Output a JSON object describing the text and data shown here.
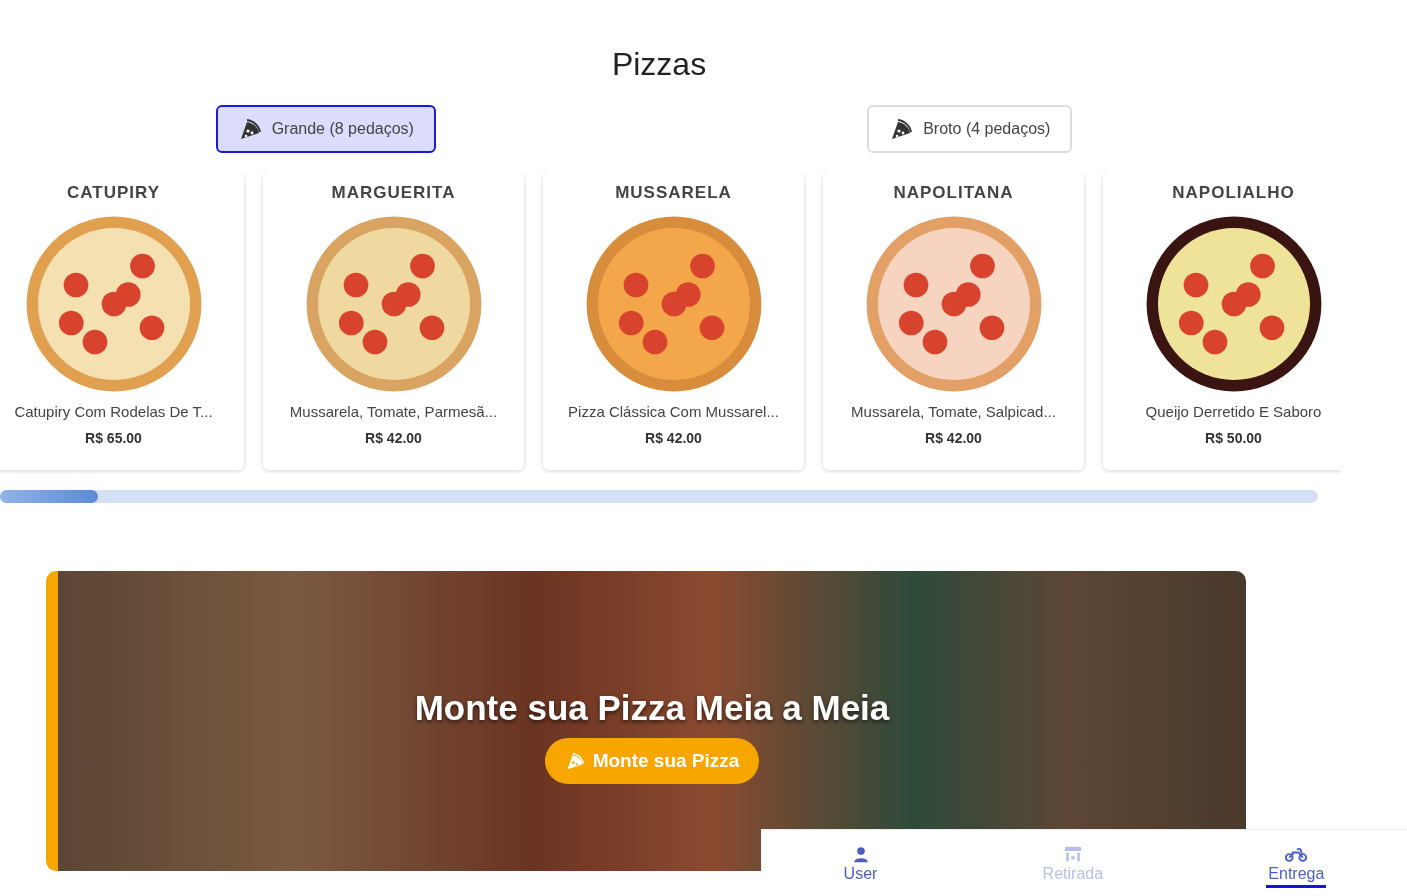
{
  "section_title": "Pizzas",
  "size_tabs": [
    {
      "label": "Grande (8 pedaços)",
      "selected": true
    },
    {
      "label": "Broto (4 pedaços)",
      "selected": false
    }
  ],
  "pizzas": [
    {
      "name": "CATUPIRY",
      "description": "Catupiry Com Rodelas De T...",
      "price": "R$ 65.00"
    },
    {
      "name": "MARGUERITA",
      "description": "Mussarela, Tomate, Parmesã...",
      "price": "R$ 42.00"
    },
    {
      "name": "MUSSARELA",
      "description": "Pizza Clássica Com Mussarel...",
      "price": "R$ 42.00"
    },
    {
      "name": "NAPOLITANA",
      "description": "Mussarela, Tomate, Salpicad...",
      "price": "R$ 42.00"
    },
    {
      "name": "NAPOLIALHO",
      "description": "Queijo Derretido E Saboro",
      "price": "R$ 50.00"
    }
  ],
  "banner": {
    "title": "Monte sua Pizza Meia a Meia",
    "button": "Monte sua Pizza"
  },
  "bottom_nav": [
    {
      "kind": "user",
      "label": "User",
      "selected": false,
      "disabled": false
    },
    {
      "kind": "store",
      "label": "Retirada",
      "selected": false,
      "disabled": true
    },
    {
      "kind": "motorcycle",
      "label": "Entrega",
      "selected": true,
      "disabled": false
    }
  ]
}
